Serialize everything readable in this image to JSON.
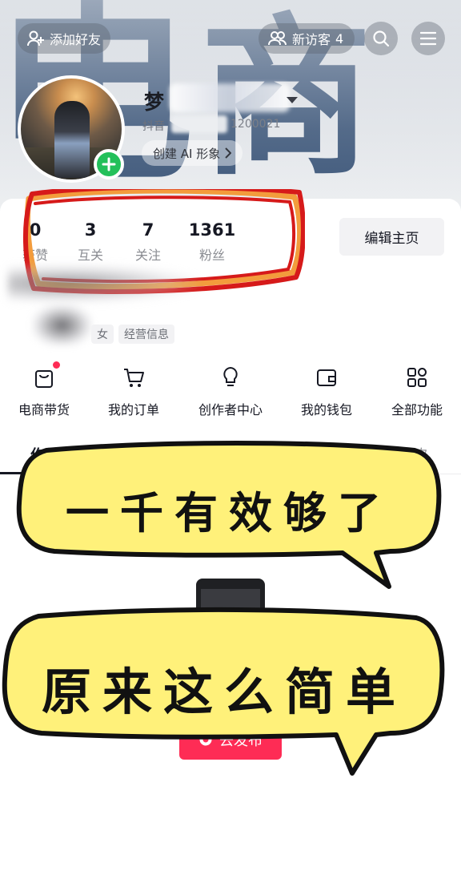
{
  "header": {
    "add_friend": "添加好友",
    "new_visitors": "新访客",
    "new_visitors_count": "4",
    "icons": [
      "add-user-icon",
      "people-icon",
      "search-icon",
      "menu-icon"
    ]
  },
  "profile": {
    "nickname_visible": "梦",
    "douyin_id_label": "抖音",
    "douyin_id_tail": "1200021",
    "create_ai": "创建 AI 形象",
    "background_text": [
      "电",
      "商"
    ]
  },
  "stats": [
    {
      "num": "0",
      "label": "获赞"
    },
    {
      "num": "3",
      "label": "互关"
    },
    {
      "num": "7",
      "label": "关注"
    },
    {
      "num": "1361",
      "label": "粉丝"
    }
  ],
  "edit_profile": "编辑主页",
  "tags": {
    "gender": "女",
    "business": "经营信息"
  },
  "quick_actions": [
    {
      "label": "电商带货",
      "icon": "shopping-bag-icon"
    },
    {
      "label": "我的订单",
      "icon": "cart-icon"
    },
    {
      "label": "创作者中心",
      "icon": "lightbulb-icon"
    },
    {
      "label": "我的钱包",
      "icon": "wallet-icon"
    },
    {
      "label": "全部功能",
      "icon": "grid-icon"
    }
  ],
  "tabs": {
    "works": "作品",
    "likes": "喜欢"
  },
  "post_button": "去发布",
  "stickers": {
    "line1": "一千有效够了",
    "line2": "原来这么简单"
  },
  "colors": {
    "accent": "#fe2c55",
    "green": "#23c05a",
    "sticker_fill": "#fff17a",
    "highlight_red": "#d61a1a",
    "highlight_orange": "#f39c3c"
  }
}
